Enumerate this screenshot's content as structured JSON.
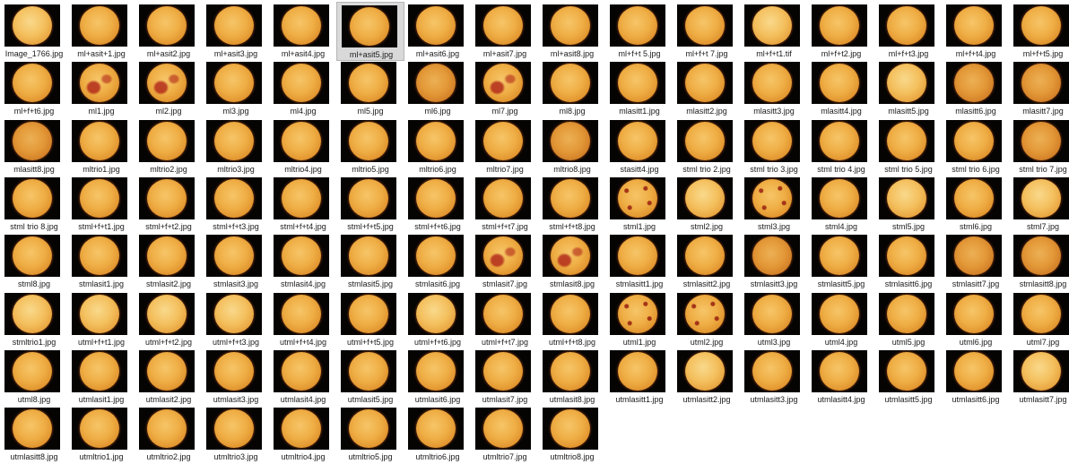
{
  "explorer": {
    "selected_index": 5,
    "files": [
      {
        "name": "Image_1766.jpg",
        "tone": "pale"
      },
      {
        "name": "ml+asit+1.jpg",
        "tone": "normal"
      },
      {
        "name": "ml+asit2.jpg",
        "tone": "normal"
      },
      {
        "name": "ml+asit3.jpg",
        "tone": "normal"
      },
      {
        "name": "ml+asit4.jpg",
        "tone": "normal"
      },
      {
        "name": "ml+asit5.jpg",
        "tone": "normal"
      },
      {
        "name": "ml+asit6.jpg",
        "tone": "normal"
      },
      {
        "name": "ml+asit7.jpg",
        "tone": "normal"
      },
      {
        "name": "ml+asit8.jpg",
        "tone": "normal"
      },
      {
        "name": "ml+f+t 5.jpg",
        "tone": "normal"
      },
      {
        "name": "ml+f+t 7.jpg",
        "tone": "normal"
      },
      {
        "name": "ml+f+t1.tif",
        "tone": "pale"
      },
      {
        "name": "ml+f+t2.jpg",
        "tone": "normal"
      },
      {
        "name": "ml+f+t3.jpg",
        "tone": "normal"
      },
      {
        "name": "ml+f+t4.jpg",
        "tone": "normal"
      },
      {
        "name": "ml+f+t5.jpg",
        "tone": "normal"
      },
      {
        "name": "ml+f+t6.jpg",
        "tone": "normal"
      },
      {
        "name": "ml1.jpg",
        "tone": "stained"
      },
      {
        "name": "ml2.jpg",
        "tone": "stained"
      },
      {
        "name": "ml3.jpg",
        "tone": "normal"
      },
      {
        "name": "ml4.jpg",
        "tone": "normal"
      },
      {
        "name": "ml5.jpg",
        "tone": "normal"
      },
      {
        "name": "ml6.jpg",
        "tone": "deep"
      },
      {
        "name": "ml7.jpg",
        "tone": "stained"
      },
      {
        "name": "ml8.jpg",
        "tone": "normal"
      },
      {
        "name": "mlasitt1.jpg",
        "tone": "normal"
      },
      {
        "name": "mlasitt2.jpg",
        "tone": "normal"
      },
      {
        "name": "mlasitt3.jpg",
        "tone": "normal"
      },
      {
        "name": "mlasitt4.jpg",
        "tone": "normal"
      },
      {
        "name": "mlasitt5.jpg",
        "tone": "pale"
      },
      {
        "name": "mlasitt6.jpg",
        "tone": "deep"
      },
      {
        "name": "mlasitt7.jpg",
        "tone": "deep"
      },
      {
        "name": "mlasitt8.jpg",
        "tone": "deep"
      },
      {
        "name": "mltrio1.jpg",
        "tone": "normal"
      },
      {
        "name": "mltrio2.jpg",
        "tone": "normal"
      },
      {
        "name": "mltrio3.jpg",
        "tone": "normal"
      },
      {
        "name": "mltrio4.jpg",
        "tone": "normal"
      },
      {
        "name": "mltrio5.jpg",
        "tone": "normal"
      },
      {
        "name": "mltrio6.jpg",
        "tone": "normal"
      },
      {
        "name": "mltrio7.jpg",
        "tone": "normal"
      },
      {
        "name": "mltrio8.jpg",
        "tone": "deep"
      },
      {
        "name": "stasitt4.jpg",
        "tone": "normal"
      },
      {
        "name": "stml trio 2.jpg",
        "tone": "normal"
      },
      {
        "name": "stml trio 3.jpg",
        "tone": "normal"
      },
      {
        "name": "stml trio 4.jpg",
        "tone": "normal"
      },
      {
        "name": "stml trio 5.jpg",
        "tone": "normal"
      },
      {
        "name": "stml trio 6.jpg",
        "tone": "normal"
      },
      {
        "name": "stml trio 7.jpg",
        "tone": "deep"
      },
      {
        "name": "stml trio 8.jpg",
        "tone": "normal"
      },
      {
        "name": "stml+f+t1.jpg",
        "tone": "normal"
      },
      {
        "name": "stml+f+t2.jpg",
        "tone": "normal"
      },
      {
        "name": "stml+f+t3.jpg",
        "tone": "normal"
      },
      {
        "name": "stml+f+t4.jpg",
        "tone": "normal"
      },
      {
        "name": "stml+f+t5.jpg",
        "tone": "normal"
      },
      {
        "name": "stml+f+t6.jpg",
        "tone": "normal"
      },
      {
        "name": "stml+f+t7.jpg",
        "tone": "normal"
      },
      {
        "name": "stml+f+t8.jpg",
        "tone": "normal"
      },
      {
        "name": "stml1.jpg",
        "tone": "spotted"
      },
      {
        "name": "stml2.jpg",
        "tone": "pale"
      },
      {
        "name": "stml3.jpg",
        "tone": "spotted"
      },
      {
        "name": "stml4.jpg",
        "tone": "normal"
      },
      {
        "name": "stml5.jpg",
        "tone": "pale"
      },
      {
        "name": "stml6.jpg",
        "tone": "normal"
      },
      {
        "name": "stml7.jpg",
        "tone": "pale"
      },
      {
        "name": "stml8.jpg",
        "tone": "normal"
      },
      {
        "name": "stmlasit1.jpg",
        "tone": "normal"
      },
      {
        "name": "stmlasit2.jpg",
        "tone": "normal"
      },
      {
        "name": "stmlasit3.jpg",
        "tone": "normal"
      },
      {
        "name": "stmlasit4.jpg",
        "tone": "normal"
      },
      {
        "name": "stmlasit5.jpg",
        "tone": "normal"
      },
      {
        "name": "stmlasit6.jpg",
        "tone": "normal"
      },
      {
        "name": "stmlasit7.jpg",
        "tone": "stained"
      },
      {
        "name": "stmlasit8.jpg",
        "tone": "stained"
      },
      {
        "name": "stmlasitt1.jpg",
        "tone": "normal"
      },
      {
        "name": "stmlasitt2.jpg",
        "tone": "normal"
      },
      {
        "name": "stmlasitt3.jpg",
        "tone": "deep"
      },
      {
        "name": "stmlasitt5.jpg",
        "tone": "normal"
      },
      {
        "name": "stmlasitt6.jpg",
        "tone": "normal"
      },
      {
        "name": "stmlasitt7.jpg",
        "tone": "deep"
      },
      {
        "name": "stmlasitt8.jpg",
        "tone": "deep"
      },
      {
        "name": "stmltrio1.jpg",
        "tone": "pale"
      },
      {
        "name": "utml+f+t1.jpg",
        "tone": "pale"
      },
      {
        "name": "utml+f+t2.jpg",
        "tone": "pale"
      },
      {
        "name": "utml+f+t3.jpg",
        "tone": "pale"
      },
      {
        "name": "utml+f+t4.jpg",
        "tone": "normal"
      },
      {
        "name": "utml+f+t5.jpg",
        "tone": "normal"
      },
      {
        "name": "utml+f+t6.jpg",
        "tone": "pale"
      },
      {
        "name": "utml+f+t7.jpg",
        "tone": "normal"
      },
      {
        "name": "utml+f+t8.jpg",
        "tone": "normal"
      },
      {
        "name": "utml1.jpg",
        "tone": "spotted"
      },
      {
        "name": "utml2.jpg",
        "tone": "spotted"
      },
      {
        "name": "utml3.jpg",
        "tone": "normal"
      },
      {
        "name": "utml4.jpg",
        "tone": "normal"
      },
      {
        "name": "utml5.jpg",
        "tone": "normal"
      },
      {
        "name": "utml6.jpg",
        "tone": "normal"
      },
      {
        "name": "utml7.jpg",
        "tone": "normal"
      },
      {
        "name": "utml8.jpg",
        "tone": "normal"
      },
      {
        "name": "utmlasit1.jpg",
        "tone": "normal"
      },
      {
        "name": "utmlasit2.jpg",
        "tone": "normal"
      },
      {
        "name": "utmlasit3.jpg",
        "tone": "normal"
      },
      {
        "name": "utmlasit4.jpg",
        "tone": "normal"
      },
      {
        "name": "utmlasit5.jpg",
        "tone": "normal"
      },
      {
        "name": "utmlasit6.jpg",
        "tone": "normal"
      },
      {
        "name": "utmlasit7.jpg",
        "tone": "normal"
      },
      {
        "name": "utmlasit8.jpg",
        "tone": "normal"
      },
      {
        "name": "utmlasitt1.jpg",
        "tone": "normal"
      },
      {
        "name": "utmlasitt2.jpg",
        "tone": "pale"
      },
      {
        "name": "utmlasitt3.jpg",
        "tone": "normal"
      },
      {
        "name": "utmlasitt4.jpg",
        "tone": "normal"
      },
      {
        "name": "utmlasitt5.jpg",
        "tone": "normal"
      },
      {
        "name": "utmlasitt6.jpg",
        "tone": "normal"
      },
      {
        "name": "utmlasitt7.jpg",
        "tone": "pale"
      },
      {
        "name": "utmlasitt8.jpg",
        "tone": "normal"
      },
      {
        "name": "utmltrio1.jpg",
        "tone": "normal"
      },
      {
        "name": "utmltrio2.jpg",
        "tone": "normal"
      },
      {
        "name": "utmltrio3.jpg",
        "tone": "normal"
      },
      {
        "name": "utmltrio4.jpg",
        "tone": "normal"
      },
      {
        "name": "utmltrio5.jpg",
        "tone": "normal"
      },
      {
        "name": "utmltrio6.jpg",
        "tone": "normal"
      },
      {
        "name": "utmltrio7.jpg",
        "tone": "normal"
      },
      {
        "name": "utmltrio8.jpg",
        "tone": "normal"
      }
    ]
  }
}
